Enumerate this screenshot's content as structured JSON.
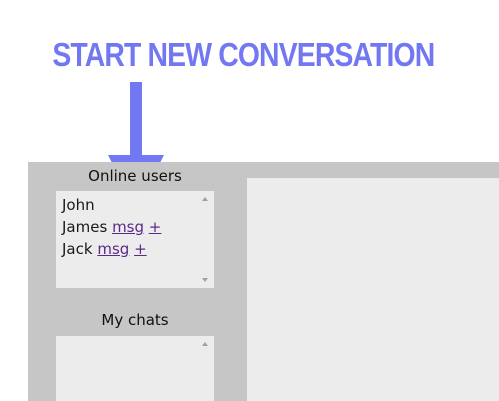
{
  "annotation": {
    "title": "START NEW CONVERSATION",
    "color": "#7278f2"
  },
  "sidebar": {
    "online_users_heading": "Online users",
    "online_users": [
      {
        "name": "John",
        "msg_link": "",
        "add_link": ""
      },
      {
        "name": "James",
        "msg_link": "msg",
        "add_link": "+"
      },
      {
        "name": "Jack",
        "msg_link": "msg",
        "add_link": "+"
      }
    ],
    "my_chats_heading": "My chats",
    "my_chats": []
  },
  "colors": {
    "frame_bg": "#c6c6c6",
    "panel_bg": "#ececec",
    "link": "#5a2a86"
  }
}
